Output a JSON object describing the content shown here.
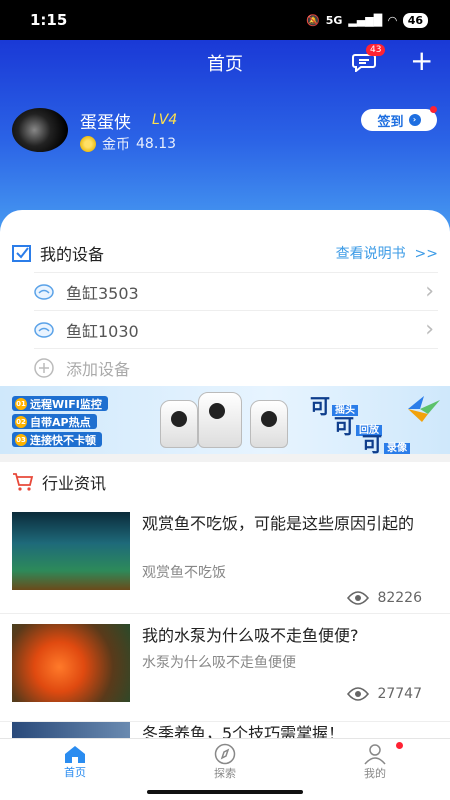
{
  "status": {
    "time": "1:15",
    "network": "5G",
    "battery": "46"
  },
  "header": {
    "title": "首页",
    "message_count": "43"
  },
  "user": {
    "name": "蛋蛋侠",
    "level": "LV4",
    "coin_label": "金币",
    "coins": "48.13",
    "checkin_label": "签到"
  },
  "devices": {
    "title": "我的设备",
    "manual_link": "查看说明书",
    "manual_arrow": ">>",
    "items": [
      {
        "label": "鱼缸3503"
      },
      {
        "label": "鱼缸1030"
      }
    ],
    "add_label": "添加设备"
  },
  "banner": {
    "lines": [
      "远程WIFI监控",
      "自带AP热点",
      "连接快不卡顿"
    ],
    "nums": [
      "01",
      "02",
      "03"
    ],
    "tags": [
      {
        "big": "可",
        "small": "摇头"
      },
      {
        "big": "可",
        "small": "回放"
      },
      {
        "big": "可",
        "small": "录像"
      }
    ]
  },
  "news": {
    "title": "行业资讯",
    "items": [
      {
        "title": "观赏鱼不吃饭，可能是这些原因引起的",
        "subtitle": "观赏鱼不吃饭",
        "views": "82226"
      },
      {
        "title": "我的水泵为什么吸不走鱼便便?",
        "subtitle": "水泵为什么吸不走鱼便便",
        "views": "27747"
      },
      {
        "title": "冬季养鱼，5个技巧需掌握！",
        "subtitle": "",
        "views": ""
      }
    ]
  },
  "tabbar": {
    "home": "首页",
    "explore": "探索",
    "mine": "我的"
  },
  "colors": {
    "accent": "#2a8cf0",
    "hero_top": "#1a39d6",
    "badge": "#ff2233"
  }
}
